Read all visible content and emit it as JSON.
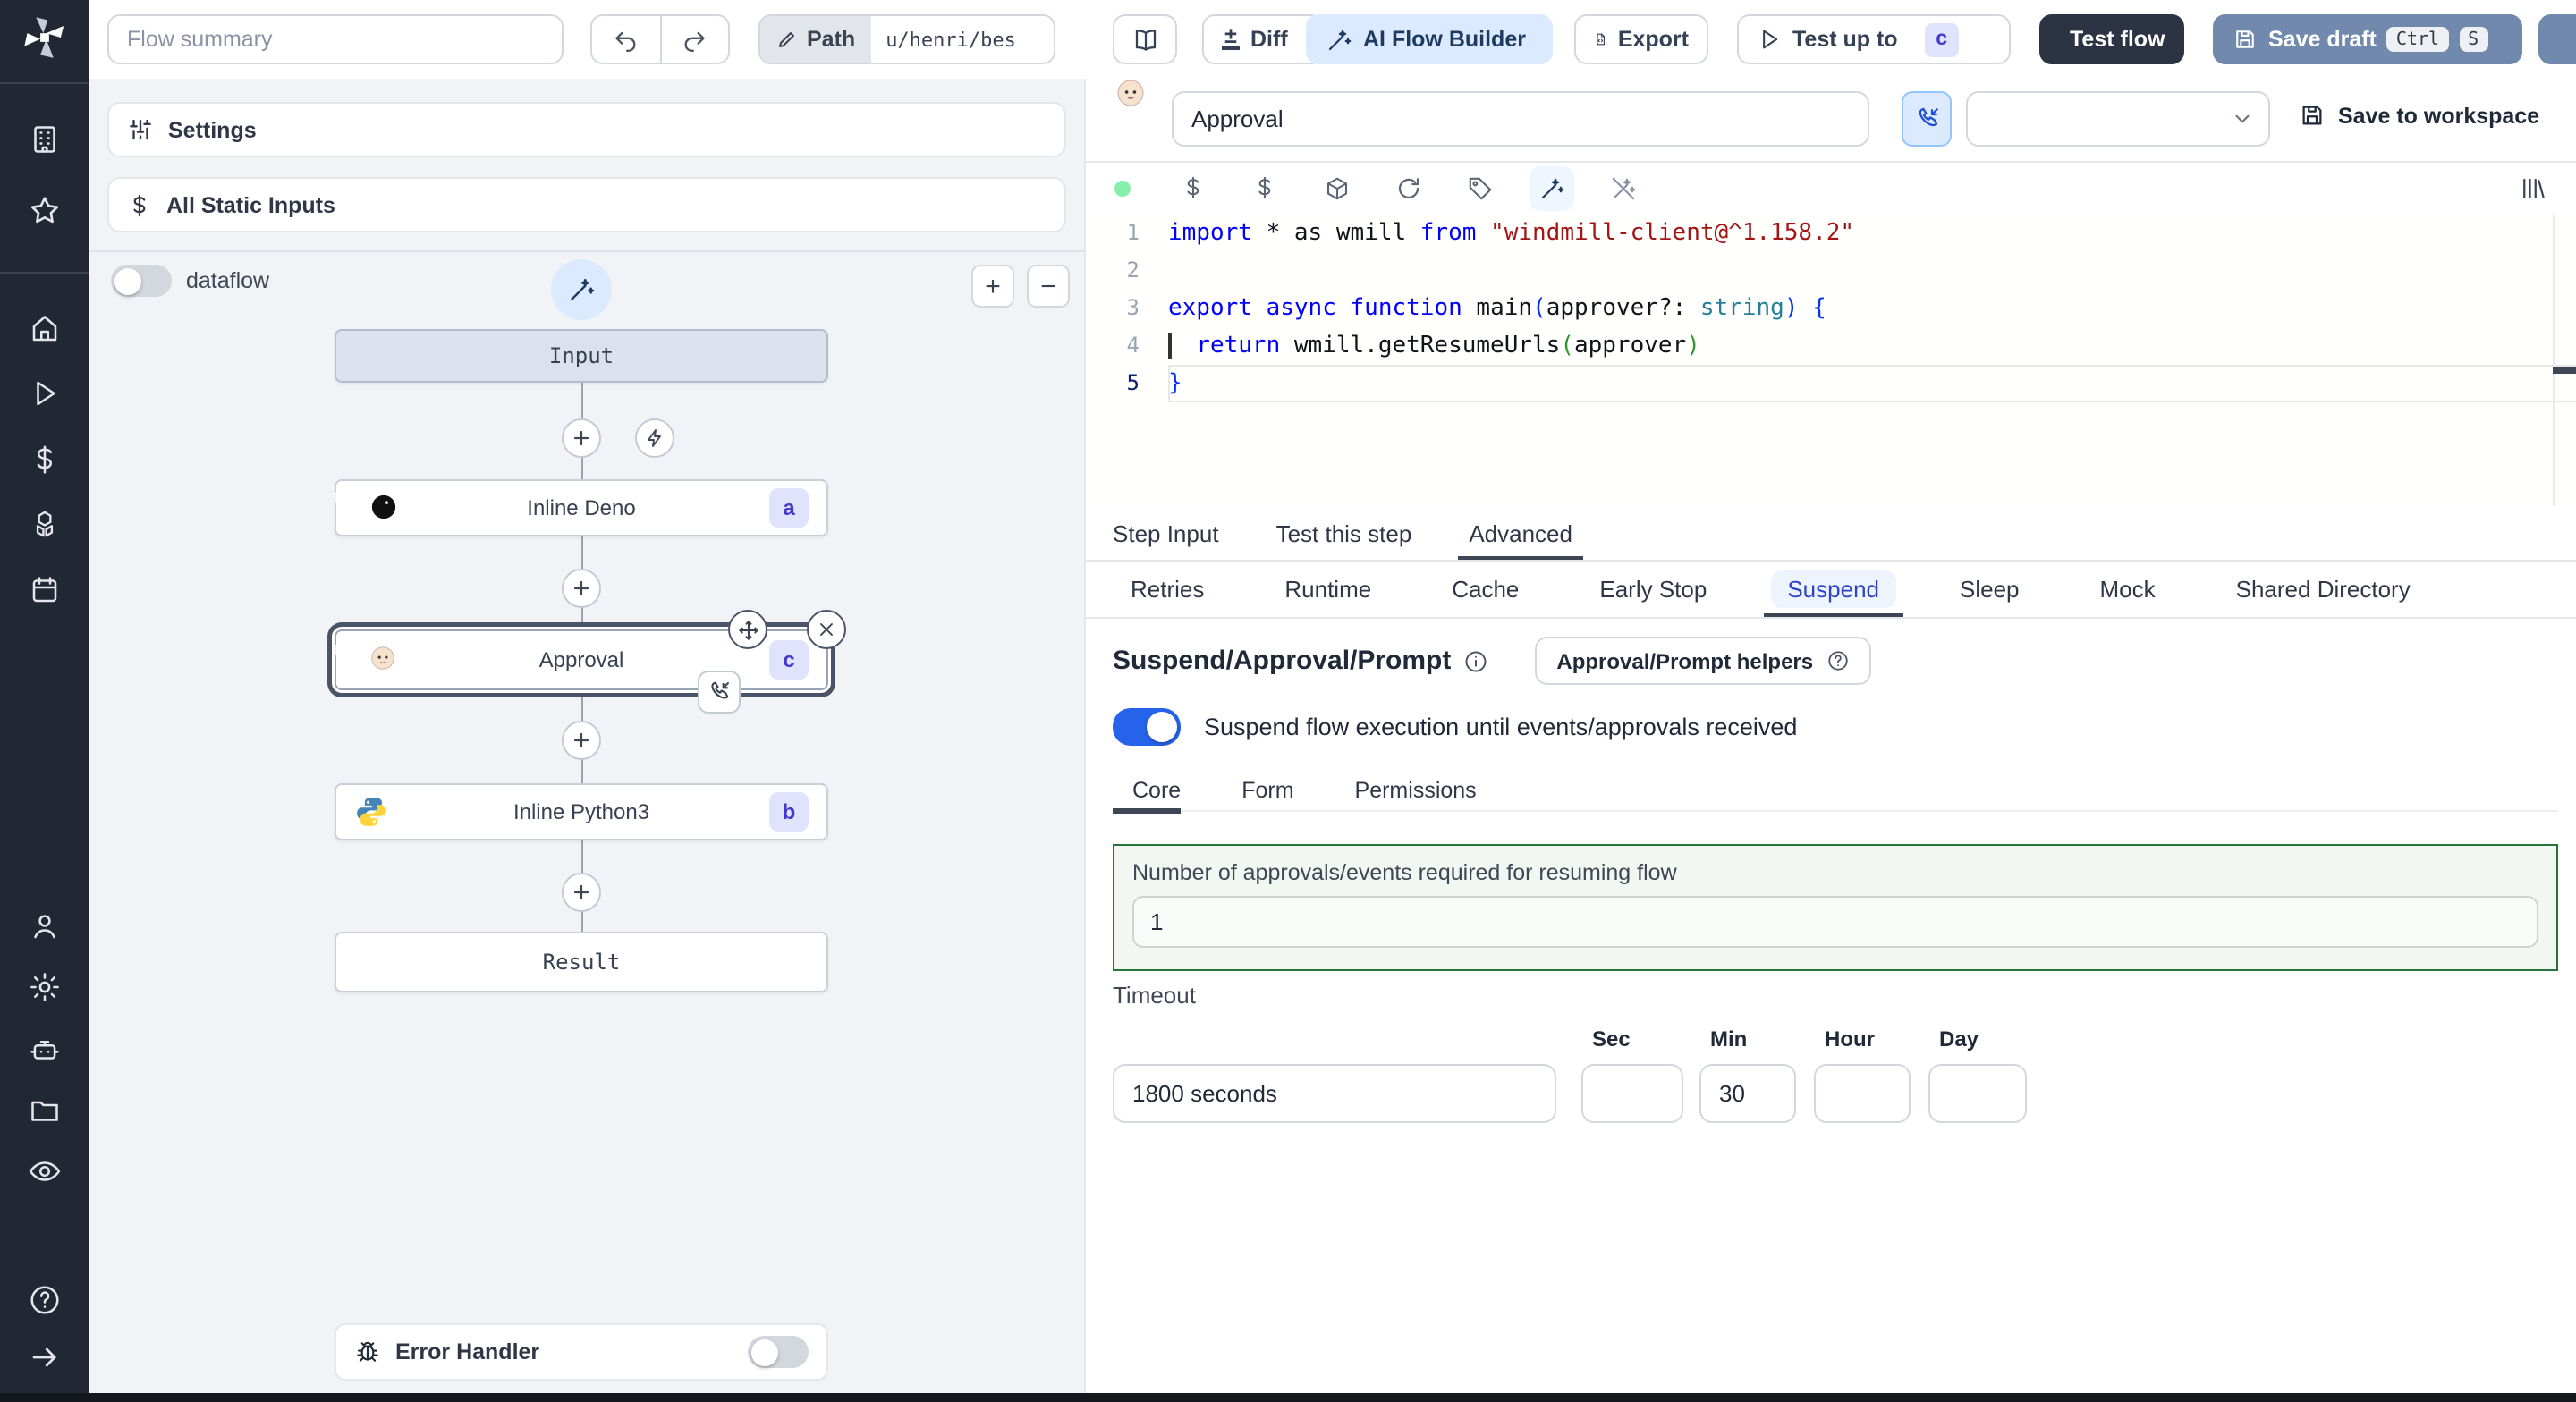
{
  "colors": {
    "rail_bg": "#212733",
    "panel_bg": "#f1f3f6",
    "accent_blue": "#2563eb",
    "ai_button_bg": "#dbeafe",
    "test_flow_button_bg": "#2c3342",
    "save_draft_button_bg": "#7089ac",
    "suspend_tab_text": "#2d44c8",
    "active_underline": "#3c4654",
    "approvals_box_border": "#27733c",
    "step_badge_bg": "#dfe3fc",
    "step_badge_text": "#4338ca",
    "code_keyword": "#0000ff",
    "code_string": "#a31515"
  },
  "topbar": {
    "flow_summary_placeholder": "Flow summary",
    "path_label": "Path",
    "path_value": "u/henri/bes",
    "diff_label": "Diff",
    "ai_flow_builder_label": "AI Flow Builder",
    "export_label": "Export",
    "test_up_to_label": "Test up to",
    "test_up_to_badge": "c",
    "test_flow_label": "Test flow",
    "save_draft_label": "Save draft",
    "kbd_ctrl": "Ctrl",
    "kbd_s": "S"
  },
  "flow_panel": {
    "settings_label": "Settings",
    "static_inputs_label": "All Static Inputs",
    "dataflow_label": "dataflow",
    "zoom_in": "+",
    "zoom_out": "−",
    "nodes": {
      "input_label": "Input",
      "deno_label": "Inline Deno",
      "deno_badge": "a",
      "approval_label": "Approval",
      "approval_badge": "c",
      "python_label": "Inline Python3",
      "python_badge": "b",
      "result_label": "Result"
    },
    "error_handler_label": "Error Handler"
  },
  "step_panel": {
    "name_value": "Approval",
    "save_to_workspace_label": "Save to workspace",
    "code": {
      "lines": [
        {
          "num": "1",
          "tokens": [
            [
              "kw",
              "import"
            ],
            [
              "pl",
              " * as wmill "
            ],
            [
              "kw",
              "from"
            ],
            [
              "str",
              " \"windmill-client@^1.158.2\""
            ]
          ]
        },
        {
          "num": "2",
          "tokens": []
        },
        {
          "num": "3",
          "tokens": [
            [
              "kw",
              "export"
            ],
            [
              "pl",
              " "
            ],
            [
              "kw",
              "async"
            ],
            [
              "pl",
              " "
            ],
            [
              "kw",
              "function"
            ],
            [
              "pl",
              " main"
            ],
            [
              "b1",
              "("
            ],
            [
              "pl",
              "approver?: "
            ],
            [
              "ty",
              "string"
            ],
            [
              "b1",
              ")"
            ],
            [
              "pl",
              " "
            ],
            [
              "b1",
              "{"
            ]
          ]
        },
        {
          "num": "4",
          "caret": true,
          "tokens": [
            [
              "pl",
              "  "
            ],
            [
              "kw",
              "return"
            ],
            [
              "pl",
              " wmill.getResumeUrls"
            ],
            [
              "b2",
              "("
            ],
            [
              "pl",
              "approver"
            ],
            [
              "b2",
              ")"
            ]
          ]
        },
        {
          "num": "5",
          "current": true,
          "tokens": [
            [
              "b1",
              "}"
            ]
          ]
        }
      ]
    },
    "tabs": {
      "step_input": "Step Input",
      "test_this_step": "Test this step",
      "advanced": "Advanced"
    },
    "advanced_tabs": {
      "retries": "Retries",
      "runtime": "Runtime",
      "cache": "Cache",
      "early_stop": "Early Stop",
      "suspend": "Suspend",
      "sleep": "Sleep",
      "mock": "Mock",
      "shared_directory": "Shared Directory"
    },
    "suspend": {
      "heading": "Suspend/Approval/Prompt",
      "helpers_button": "Approval/Prompt helpers",
      "toggle_label": "Suspend flow execution until events/approvals received",
      "tabs": {
        "core": "Core",
        "form": "Form",
        "permissions": "Permissions"
      },
      "approvals_label": "Number of approvals/events required for resuming flow",
      "approvals_value": "1",
      "timeout_label": "Timeout",
      "timeout_value": "1800 seconds",
      "units": {
        "sec": "Sec",
        "min": "Min",
        "hour": "Hour",
        "day": "Day"
      },
      "sec_value": "",
      "min_value": "30",
      "hour_value": "",
      "day_value": ""
    }
  }
}
